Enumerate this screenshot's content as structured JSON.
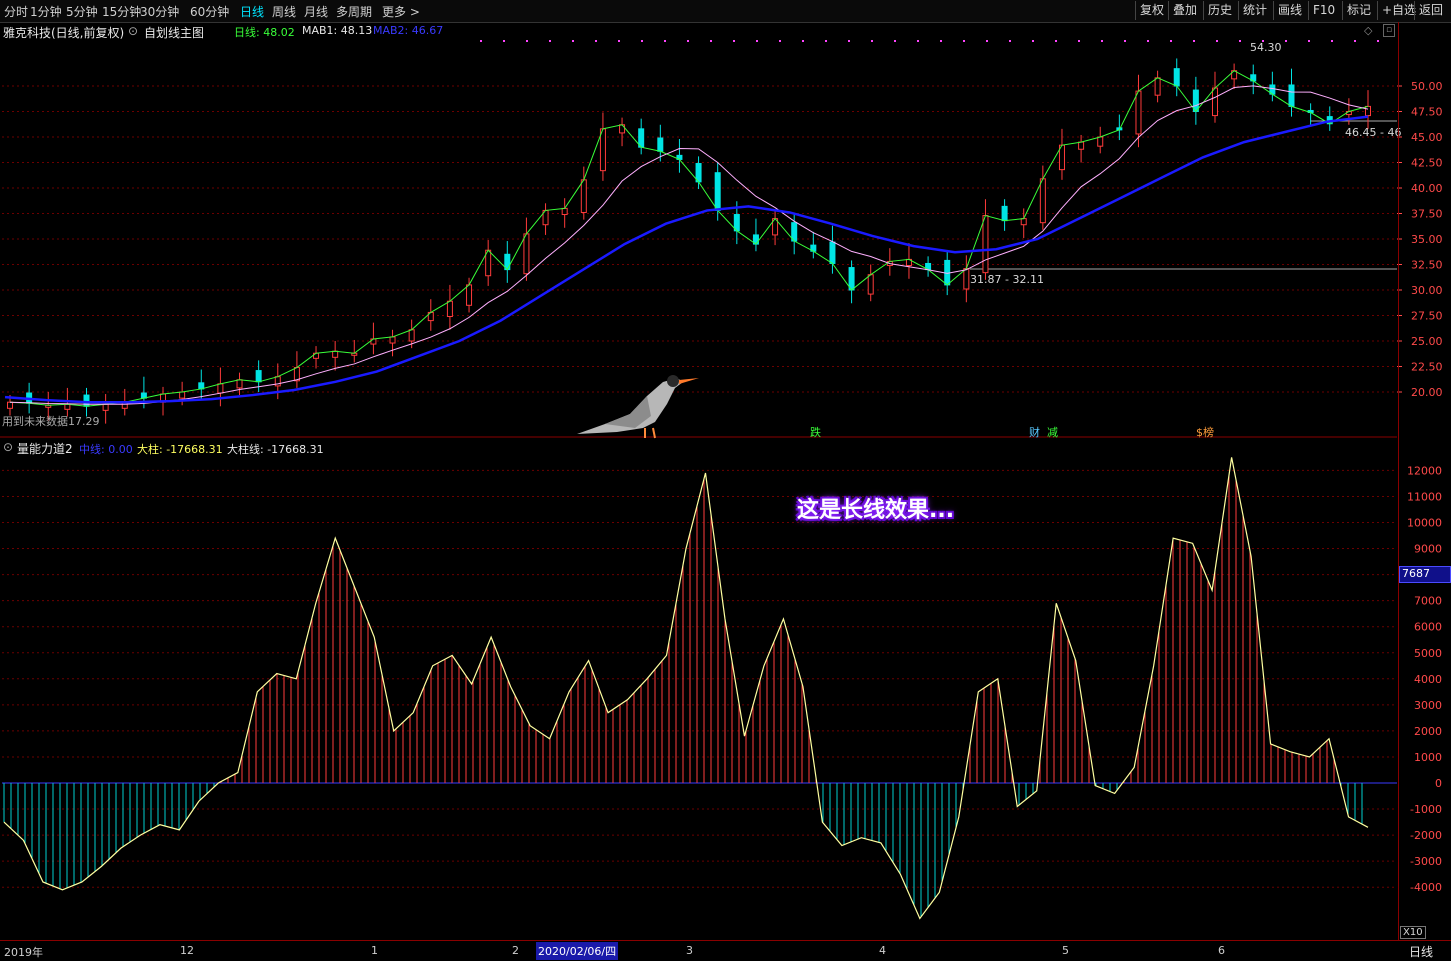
{
  "toolbar": {
    "periods": [
      "分时",
      "1分钟",
      "5分钟",
      "15分钟",
      "30分钟",
      "60分钟",
      "日线",
      "周线",
      "月线",
      "多周期",
      "更多 >"
    ],
    "active_period": "日线",
    "right_buttons": [
      "复权",
      "叠加",
      "历史",
      "统计",
      "画线",
      "F10",
      "标记",
      "+自选",
      "返回"
    ]
  },
  "main_panel": {
    "stock_title": "雅克科技(日线,前复权)",
    "template": "自划线主图",
    "indicators": {
      "day_label": "日线: 48.02",
      "mab1_label": "MAB1: 48.13",
      "mab2_label": "MAB2: 46.67"
    },
    "annotations": {
      "high": "54.30",
      "range_low": "31.87 - 32.11",
      "range_right": "46.45 - 46",
      "left_note": "用到未来数据17.29"
    },
    "event_markers": [
      "跌",
      "财",
      "减",
      "$榜"
    ],
    "y_ticks": [
      "50.00",
      "47.50",
      "45.00",
      "42.50",
      "40.00",
      "37.50",
      "35.00",
      "32.50",
      "30.00",
      "27.50",
      "25.00",
      "22.50",
      "20.00"
    ],
    "y_range": [
      17.5,
      54.5
    ]
  },
  "sub_panel": {
    "title": "量能力道2",
    "mid_label": "中线: 0.00",
    "big_bar_label": "大柱: -17668.31",
    "big_line_label": "大柱线: -17668.31",
    "overlay_text": "这是长线效果...",
    "y_ticks": [
      "12000",
      "11000",
      "10000",
      "9000",
      "8000",
      "7000",
      "6000",
      "5000",
      "4000",
      "3000",
      "2000",
      "1000",
      "0",
      "-1000",
      "-2000",
      "-3000",
      "-4000"
    ],
    "current_value_tag": "7687",
    "multiplier_tag": "X10"
  },
  "x_axis": {
    "labels": [
      "2019年",
      "12",
      "1",
      "2",
      "2020/02/06/四",
      "3",
      "4",
      "5",
      "6"
    ],
    "period_tag": "日线"
  },
  "colors": {
    "up": "#ff3b3b",
    "down": "#00e5e5",
    "mab1": "#ffb0ff",
    "mab2": "#1a1aff",
    "grid": "#6b0000",
    "osc_pos": "#ff3b3b",
    "osc_neg": "#00d0d0",
    "osc_line": "#ffffa0",
    "overlay": "#a83bff"
  },
  "chart_data": {
    "type": "candlestick",
    "close_path": [
      19.0,
      18.9,
      18.7,
      18.8,
      18.6,
      18.8,
      19.0,
      19.4,
      19.8,
      20.0,
      20.3,
      20.8,
      21.2,
      21.0,
      21.5,
      22.4,
      23.8,
      24.0,
      23.8,
      25.2,
      25.4,
      26.1,
      27.8,
      28.9,
      30.5,
      33.9,
      32.0,
      35.5,
      37.8,
      38.0,
      40.8,
      45.8,
      46.2,
      44.0,
      43.6,
      42.8,
      40.6,
      37.8,
      35.8,
      34.5,
      37.0,
      34.8,
      33.8,
      32.6,
      30.0,
      31.5,
      32.8,
      33.0,
      32.0,
      30.5,
      32.1,
      37.3,
      36.8,
      37.0,
      40.9,
      44.2,
      44.5,
      45.0,
      45.7,
      49.5,
      50.8,
      50.0,
      47.5,
      49.8,
      51.5,
      50.5,
      49.2,
      48.0,
      47.4,
      46.3,
      47.5,
      48.0
    ],
    "mab2_path": [
      19.5,
      19.2,
      19.0,
      19.0,
      19.1,
      19.3,
      19.7,
      20.2,
      21.0,
      22.0,
      23.5,
      25.0,
      27.0,
      29.5,
      32.0,
      34.5,
      36.5,
      37.8,
      38.2,
      37.6,
      36.5,
      35.3,
      34.3,
      33.7,
      34.0,
      35.0,
      37.0,
      39.0,
      41.0,
      43.0,
      44.5,
      45.5,
      46.5,
      47.0
    ],
    "oscillator": [
      -1500,
      -2200,
      -3800,
      -4100,
      -3800,
      -3200,
      -2500,
      -2000,
      -1600,
      -1800,
      -700,
      0,
      400,
      3500,
      4200,
      4000,
      6900,
      9400,
      7500,
      5600,
      2000,
      2700,
      4500,
      4900,
      3800,
      5600,
      3700,
      2200,
      1700,
      3500,
      4700,
      2700,
      3200,
      4000,
      4900,
      9000,
      11900,
      6300,
      1800,
      4500,
      6300,
      3700,
      -1500,
      -2400,
      -2100,
      -2300,
      -3500,
      -5200,
      -4200,
      -1300,
      3500,
      4000,
      -900,
      -300,
      6900,
      4700,
      -100,
      -400,
      600,
      4500,
      9400,
      9200,
      7400,
      12500,
      8700,
      1500,
      1200,
      1000,
      1700,
      -1300,
      -1700
    ]
  }
}
